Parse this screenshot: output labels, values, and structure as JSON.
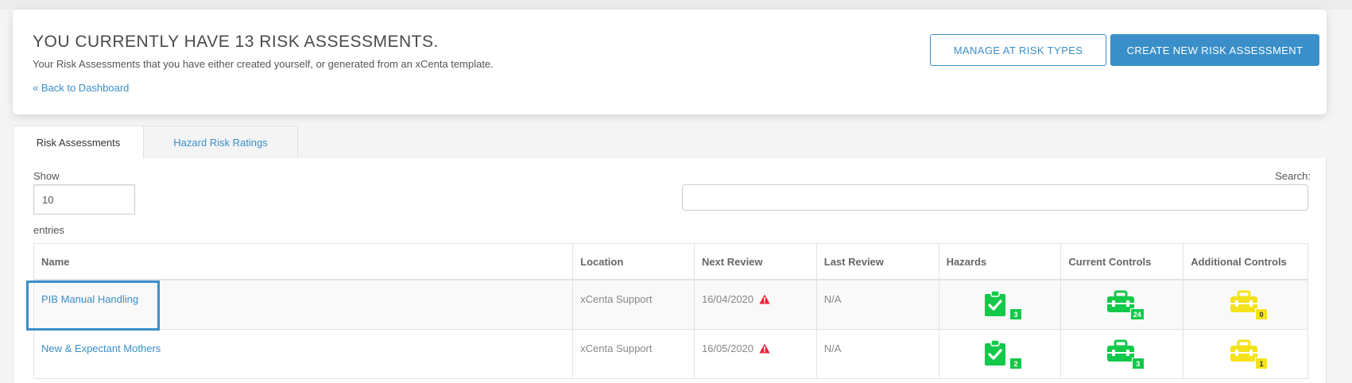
{
  "header": {
    "title": "YOU CURRENTLY HAVE 13 RISK ASSESSMENTS.",
    "subtitle": "Your Risk Assessments that you have either created yourself, or generated from an xCenta template.",
    "back_link": "« Back to Dashboard",
    "manage_button": "MANAGE AT RISK TYPES",
    "create_button": "CREATE NEW RISK ASSESSMENT"
  },
  "tabs": [
    {
      "label": "Risk Assessments",
      "active": true
    },
    {
      "label": "Hazard Risk Ratings",
      "active": false
    }
  ],
  "controls": {
    "show_label": "Show",
    "show_value": "10",
    "entries_label": "entries",
    "search_label": "Search:"
  },
  "table": {
    "columns": [
      "Name",
      "Location",
      "Next Review",
      "Last Review",
      "Hazards",
      "Current Controls",
      "Additional Controls"
    ],
    "rows": [
      {
        "name": "PIB Manual Handling",
        "location": "xCenta Support",
        "next_review": "16/04/2020",
        "last_review": "N/A",
        "hazards": "3",
        "current_controls": "24",
        "additional_controls": "0"
      },
      {
        "name": "New & Expectant Mothers",
        "location": "xCenta Support",
        "next_review": "16/05/2020",
        "last_review": "N/A",
        "hazards": "2",
        "current_controls": "3",
        "additional_controls": "1"
      }
    ]
  },
  "colors": {
    "accent": "#3a8fc9",
    "green": "#13c94a",
    "yellow": "#f4e21a",
    "warning": "#e8263b"
  },
  "icons": {
    "hazards": "clipboard-check-icon",
    "current_controls": "toolbox-icon",
    "additional_controls": "toolbox-icon",
    "overdue": "warning-triangle-icon"
  }
}
